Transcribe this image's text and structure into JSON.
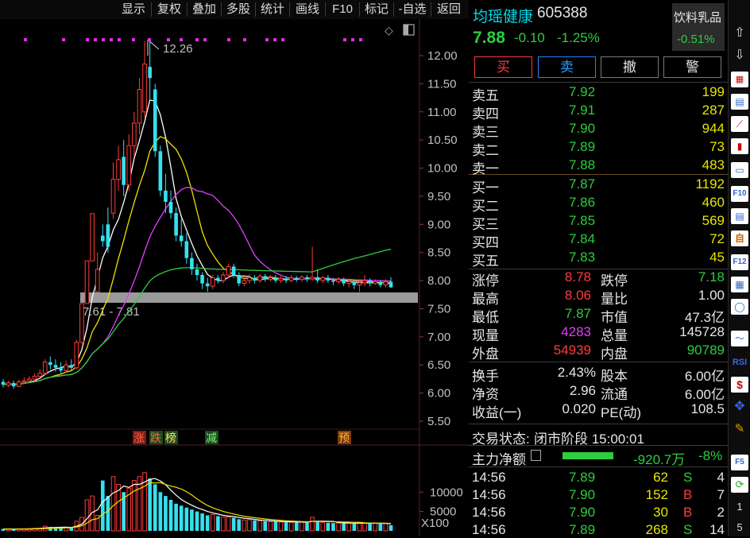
{
  "toolbar": {
    "items": [
      "显示",
      "复权",
      "叠加",
      "多股",
      "统计",
      "画线",
      "F10",
      "标记",
      "-自选",
      "返回"
    ]
  },
  "stock": {
    "name": "均瑶健康",
    "code": "605388",
    "price": "7.88",
    "change": "-0.10",
    "change_pct": "-1.25%",
    "sector": "饮料乳品",
    "sector_pct": "-0.51%"
  },
  "trade_buttons": [
    "买",
    "卖",
    "撤",
    "警"
  ],
  "order_book": {
    "asks": [
      {
        "label": "卖五",
        "price": "7.92",
        "vol": "199"
      },
      {
        "label": "卖四",
        "price": "7.91",
        "vol": "287"
      },
      {
        "label": "卖三",
        "price": "7.90",
        "vol": "944"
      },
      {
        "label": "卖二",
        "price": "7.89",
        "vol": "73"
      },
      {
        "label": "卖一",
        "price": "7.88",
        "vol": "483"
      }
    ],
    "bids": [
      {
        "label": "买一",
        "price": "7.87",
        "vol": "1192"
      },
      {
        "label": "买二",
        "price": "7.86",
        "vol": "460"
      },
      {
        "label": "买三",
        "price": "7.85",
        "vol": "569"
      },
      {
        "label": "买四",
        "price": "7.84",
        "vol": "72"
      },
      {
        "label": "买五",
        "price": "7.83",
        "vol": "45"
      }
    ]
  },
  "stats1": [
    {
      "l1": "涨停",
      "v1": "8.78",
      "c1": "red",
      "l2": "跌停",
      "v2": "7.18",
      "c2": "green"
    },
    {
      "l1": "最高",
      "v1": "8.06",
      "c1": "red",
      "l2": "量比",
      "v2": "1.00",
      "c2": "white"
    },
    {
      "l1": "最低",
      "v1": "7.87",
      "c1": "green",
      "l2": "市值",
      "v2": "47.3亿",
      "c2": "white"
    },
    {
      "l1": "现量",
      "v1": "4283",
      "c1": "mag",
      "l2": "总量",
      "v2": "145728",
      "c2": "white"
    },
    {
      "l1": "外盘",
      "v1": "54939",
      "c1": "red",
      "l2": "内盘",
      "v2": "90789",
      "c2": "green"
    }
  ],
  "stats2": [
    {
      "l1": "换手",
      "v1": "2.43%",
      "l2": "股本",
      "v2": "6.00亿"
    },
    {
      "l1": "净资",
      "v1": "2.96",
      "l2": "流通",
      "v2": "6.00亿"
    },
    {
      "l1": "收益(一)",
      "v1": "0.020",
      "l2": "PE(动)",
      "v2": "108.5"
    }
  ],
  "status": {
    "label": "交易状态:",
    "value": "闭市阶段 15:00:01"
  },
  "main_flow": {
    "label": "主力净额",
    "value": "-920.7万",
    "pct": "-8%"
  },
  "ticks": [
    {
      "time": "14:56",
      "price": "7.89",
      "vol": "62",
      "side": "S",
      "n": "4"
    },
    {
      "time": "14:56",
      "price": "7.90",
      "vol": "152",
      "side": "B",
      "n": "7"
    },
    {
      "time": "14:56",
      "price": "7.90",
      "vol": "30",
      "side": "B",
      "n": "2"
    },
    {
      "time": "14:56",
      "price": "7.89",
      "vol": "268",
      "side": "S",
      "n": "14"
    }
  ],
  "chart_labels": {
    "high_label": "12.26",
    "range_label": "7.61 - 7.81",
    "event_tags": [
      "涨",
      "跌",
      "榜",
      "减",
      "预"
    ],
    "vol_unit": "X100",
    "price_ticks": [
      "12.00",
      "11.50",
      "11.00",
      "10.50",
      "10.00",
      "9.50",
      "9.00",
      "8.50",
      "8.00",
      "7.50",
      "7.00",
      "6.50",
      "6.00",
      "5.50"
    ],
    "vol_ticks": [
      "10000",
      "5000"
    ]
  },
  "chart_data": {
    "type": "candlestick",
    "ylim": [
      5.3,
      12.5
    ],
    "candles": [
      {
        "o": 6.2,
        "c": 6.15,
        "h": 6.25,
        "l": 6.1
      },
      {
        "o": 6.14,
        "c": 6.18,
        "h": 6.22,
        "l": 6.1
      },
      {
        "o": 6.18,
        "c": 6.12,
        "h": 6.22,
        "l": 6.08
      },
      {
        "o": 6.12,
        "c": 6.2,
        "h": 6.24,
        "l": 6.1
      },
      {
        "o": 6.2,
        "c": 6.22,
        "h": 6.28,
        "l": 6.16
      },
      {
        "o": 6.22,
        "c": 6.25,
        "h": 6.3,
        "l": 6.18
      },
      {
        "o": 6.25,
        "c": 6.3,
        "h": 6.35,
        "l": 6.2
      },
      {
        "o": 6.3,
        "c": 6.35,
        "h": 6.42,
        "l": 6.28
      },
      {
        "o": 6.35,
        "c": 6.55,
        "h": 6.6,
        "l": 6.32
      },
      {
        "o": 6.55,
        "c": 6.5,
        "h": 6.65,
        "l": 6.42
      },
      {
        "o": 6.5,
        "c": 6.45,
        "h": 6.6,
        "l": 6.38
      },
      {
        "o": 6.45,
        "c": 6.4,
        "h": 6.55,
        "l": 6.35
      },
      {
        "o": 6.4,
        "c": 6.5,
        "h": 6.58,
        "l": 6.36
      },
      {
        "o": 6.5,
        "c": 6.45,
        "h": 6.6,
        "l": 6.4
      },
      {
        "o": 6.45,
        "c": 6.9,
        "h": 6.95,
        "l": 6.42
      },
      {
        "o": 6.9,
        "c": 7.59,
        "h": 7.59,
        "l": 6.88
      },
      {
        "o": 7.59,
        "c": 8.35,
        "h": 8.35,
        "l": 7.59
      },
      {
        "o": 8.35,
        "c": 9.19,
        "h": 9.19,
        "l": 8.35
      },
      {
        "o": 7.8,
        "c": 8.2,
        "h": 8.5,
        "l": 7.8
      },
      {
        "o": 8.8,
        "c": 8.7,
        "h": 9.0,
        "l": 8.6
      },
      {
        "o": 9.0,
        "c": 8.6,
        "h": 9.3,
        "l": 8.5
      },
      {
        "o": 9.2,
        "c": 9.8,
        "h": 10.1,
        "l": 9.1
      },
      {
        "o": 9.8,
        "c": 10.15,
        "h": 10.4,
        "l": 9.6
      },
      {
        "o": 10.2,
        "c": 9.7,
        "h": 10.5,
        "l": 9.5
      },
      {
        "o": 9.7,
        "c": 10.4,
        "h": 10.6,
        "l": 9.6
      },
      {
        "o": 10.4,
        "c": 10.8,
        "h": 11.0,
        "l": 10.2
      },
      {
        "o": 10.8,
        "c": 11.4,
        "h": 11.6,
        "l": 10.6
      },
      {
        "o": 11.0,
        "c": 11.85,
        "h": 12.26,
        "l": 10.9
      },
      {
        "o": 11.8,
        "c": 11.6,
        "h": 12.26,
        "l": 11.2
      },
      {
        "o": 11.4,
        "c": 10.3,
        "h": 11.5,
        "l": 10.2
      },
      {
        "o": 10.3,
        "c": 9.6,
        "h": 10.4,
        "l": 9.5
      },
      {
        "o": 9.6,
        "c": 9.4,
        "h": 9.9,
        "l": 9.2
      },
      {
        "o": 9.4,
        "c": 9.2,
        "h": 9.6,
        "l": 9.1
      },
      {
        "o": 9.2,
        "c": 8.8,
        "h": 9.3,
        "l": 8.7
      },
      {
        "o": 8.8,
        "c": 8.7,
        "h": 9.1,
        "l": 8.6
      },
      {
        "o": 8.7,
        "c": 8.4,
        "h": 8.85,
        "l": 8.3
      },
      {
        "o": 8.4,
        "c": 8.2,
        "h": 8.5,
        "l": 8.1
      },
      {
        "o": 8.2,
        "c": 8.1,
        "h": 8.3,
        "l": 8.0
      },
      {
        "o": 8.1,
        "c": 7.95,
        "h": 8.15,
        "l": 7.85
      },
      {
        "o": 7.95,
        "c": 7.9,
        "h": 8.05,
        "l": 7.8
      },
      {
        "o": 7.9,
        "c": 8.05,
        "h": 8.1,
        "l": 7.85
      },
      {
        "o": 8.05,
        "c": 8.0,
        "h": 8.1,
        "l": 7.95
      },
      {
        "o": 8.0,
        "c": 8.1,
        "h": 8.15,
        "l": 7.95
      },
      {
        "o": 8.1,
        "c": 8.25,
        "h": 8.3,
        "l": 8.05
      },
      {
        "o": 8.25,
        "c": 8.1,
        "h": 8.3,
        "l": 8.05
      },
      {
        "o": 8.1,
        "c": 7.95,
        "h": 8.15,
        "l": 7.9
      },
      {
        "o": 7.95,
        "c": 8.0,
        "h": 8.08,
        "l": 7.9
      },
      {
        "o": 8.0,
        "c": 8.05,
        "h": 8.12,
        "l": 7.95
      },
      {
        "o": 8.05,
        "c": 8.0,
        "h": 8.1,
        "l": 7.95
      },
      {
        "o": 8.0,
        "c": 8.08,
        "h": 8.12,
        "l": 7.96
      },
      {
        "o": 8.08,
        "c": 8.02,
        "h": 8.12,
        "l": 7.98
      },
      {
        "o": 8.02,
        "c": 8.05,
        "h": 8.1,
        "l": 7.98
      },
      {
        "o": 8.05,
        "c": 8.0,
        "h": 8.1,
        "l": 7.96
      },
      {
        "o": 8.0,
        "c": 8.04,
        "h": 8.08,
        "l": 7.96
      },
      {
        "o": 8.04,
        "c": 8.0,
        "h": 8.08,
        "l": 7.96
      },
      {
        "o": 8.0,
        "c": 8.05,
        "h": 8.1,
        "l": 7.97
      },
      {
        "o": 8.05,
        "c": 8.02,
        "h": 8.08,
        "l": 7.98
      },
      {
        "o": 8.02,
        "c": 8.06,
        "h": 8.1,
        "l": 7.98
      },
      {
        "o": 8.06,
        "c": 8.03,
        "h": 8.1,
        "l": 7.98
      },
      {
        "o": 8.03,
        "c": 8.06,
        "h": 8.6,
        "l": 8.0
      },
      {
        "o": 8.06,
        "c": 8.0,
        "h": 8.2,
        "l": 7.96
      },
      {
        "o": 8.0,
        "c": 8.05,
        "h": 8.08,
        "l": 7.96
      },
      {
        "o": 8.05,
        "c": 8.0,
        "h": 8.1,
        "l": 7.96
      },
      {
        "o": 8.0,
        "c": 7.98,
        "h": 8.05,
        "l": 7.92
      },
      {
        "o": 7.98,
        "c": 8.02,
        "h": 8.06,
        "l": 7.94
      },
      {
        "o": 8.02,
        "c": 7.95,
        "h": 8.05,
        "l": 7.9
      },
      {
        "o": 7.95,
        "c": 7.98,
        "h": 8.02,
        "l": 7.88
      },
      {
        "o": 7.98,
        "c": 7.92,
        "h": 8.0,
        "l": 7.85
      },
      {
        "o": 7.92,
        "c": 7.96,
        "h": 8.0,
        "l": 7.8
      },
      {
        "o": 7.96,
        "c": 8.0,
        "h": 8.1,
        "l": 7.9
      },
      {
        "o": 8.0,
        "c": 7.95,
        "h": 8.04,
        "l": 7.9
      },
      {
        "o": 7.95,
        "c": 7.98,
        "h": 8.02,
        "l": 7.92
      },
      {
        "o": 7.98,
        "c": 7.92,
        "h": 8.0,
        "l": 7.88
      },
      {
        "o": 7.92,
        "c": 7.98,
        "h": 8.02,
        "l": 7.88
      },
      {
        "o": 7.98,
        "c": 7.88,
        "h": 8.06,
        "l": 7.87
      }
    ],
    "volume": [
      500,
      450,
      400,
      500,
      520,
      600,
      650,
      700,
      1200,
      1000,
      900,
      850,
      900,
      800,
      2500,
      3500,
      8000,
      9000,
      4000,
      13000,
      9000,
      14000,
      12000,
      10000,
      11000,
      13000,
      14000,
      15000,
      13500,
      12000,
      10000,
      9000,
      8000,
      7000,
      6500,
      6000,
      5500,
      5000,
      4500,
      4000,
      4200,
      3800,
      3500,
      3600,
      3400,
      3000,
      2800,
      2900,
      2700,
      2600,
      2500,
      2400,
      2450,
      2300,
      2350,
      2200,
      2300,
      2250,
      2100,
      3500,
      2400,
      2200,
      2100,
      2000,
      2050,
      2000,
      1950,
      1900,
      2100,
      2000,
      1900,
      1950,
      1850,
      1900,
      1457
    ]
  }
}
